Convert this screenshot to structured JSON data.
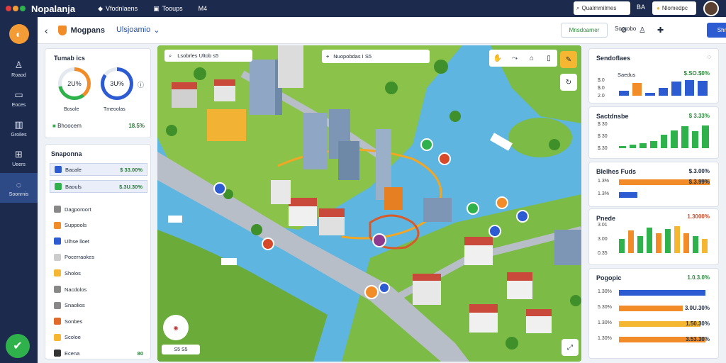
{
  "topbar": {
    "brand": "Nopalanja",
    "nav": [
      "Vfodnlaens",
      "Tooups",
      "M4"
    ],
    "search_placeholder": "Qualmmilmes",
    "lang": "BA",
    "notify_label": "Nlomedpc"
  },
  "leftnav": {
    "items": [
      {
        "label": "Roaod",
        "icon": "person-icon"
      },
      {
        "label": "Eoces",
        "icon": "inbox-icon"
      },
      {
        "label": "Groiles",
        "icon": "chart-icon"
      },
      {
        "label": "Ueers",
        "icon": "grid-icon"
      },
      {
        "label": "Soonrnis",
        "icon": "chat-icon"
      }
    ]
  },
  "subbar": {
    "title": "Mogpans",
    "dropdown": "Ulsjoamio",
    "btn_outline": "Mnsdoarner",
    "btn_text": "Soorobo",
    "btn_primary": "Shnaler"
  },
  "gauges": {
    "title": "Tumab ics",
    "g1_value": "2U%",
    "g1_label": "Bosole",
    "g2_value": "3U%",
    "g2_label": "Tmeoolas",
    "row_label": "Bhoocem",
    "row_value": "18.5%",
    "g1_pct": 0.72,
    "g2_pct": 0.85
  },
  "list": {
    "title": "Snaponna",
    "items": [
      {
        "label": "Bacale",
        "value": "$ 33.00%",
        "color": "#2d5bd1"
      },
      {
        "label": "Baouls",
        "value": "$.3U.30%",
        "color": "#2fb24c"
      },
      {
        "label": "Dagporoort",
        "value": "",
        "color": "#888888"
      },
      {
        "label": "Suppools",
        "value": "",
        "color": "#f28c28"
      },
      {
        "label": "Ulhse lloet",
        "value": "",
        "color": "#2d5bd1"
      },
      {
        "label": "Pocerraokes",
        "value": "",
        "color": "#cccccc"
      },
      {
        "label": "Sholos",
        "value": "",
        "color": "#f5b731"
      },
      {
        "label": "Nacdolos",
        "value": "",
        "color": "#888888"
      },
      {
        "label": "Snaolios",
        "value": "",
        "color": "#888888"
      },
      {
        "label": "Sonbes",
        "value": "",
        "color": "#e06a2a"
      },
      {
        "label": "Scoloe",
        "value": "",
        "color": "#f5b731"
      },
      {
        "label": "Ecena",
        "value": "80",
        "color": "#333333"
      }
    ]
  },
  "map": {
    "search_text": "Lsobrles  Ultob  s5",
    "search2_text": "Nuopobdas  I  S5",
    "coords": "S5 S5"
  },
  "right": {
    "c1": {
      "title": "Sendoflaes",
      "sub": "Saedus",
      "value": "$.SO.$0%",
      "ticks": [
        "$.0",
        "$.0",
        "2.0"
      ],
      "bars": [
        0.3,
        0.8,
        0.2,
        0.5,
        0.9,
        1.0,
        0.95
      ]
    },
    "c2": {
      "title": "Sactdnsbe",
      "value": "$ 3.33%",
      "ticks": [
        "$ 30",
        "$ 30",
        "$.30"
      ],
      "bars": [
        0.1,
        0.15,
        0.2,
        0.3,
        0.55,
        0.75,
        0.9,
        0.7,
        0.95
      ]
    },
    "c3": {
      "title": "Blelhes Fuds",
      "value": "$.3.00%",
      "ticks": [
        "1.3%",
        "1.3%"
      ],
      "bars": [
        1.0,
        0.2
      ],
      "bar_values": [
        "$.3.99%",
        ""
      ]
    },
    "c4": {
      "title": "Pnede",
      "value": "1.3000%",
      "ticks": [
        "3.01",
        "3.00",
        "0.35"
      ],
      "bars": [
        0.5,
        0.8,
        0.6,
        0.9,
        0.7,
        0.85,
        0.95,
        0.7,
        0.6,
        0.5
      ]
    },
    "c5": {
      "title": "Pogopic",
      "value": "1.0.3.0%",
      "ticks": [
        "1.30%",
        "5.30%",
        "1.30%",
        "1.30%"
      ],
      "bars": [
        0.95,
        0.7,
        0.9,
        0.95
      ],
      "bar_values": [
        "",
        "3.0U.30%",
        "1.50.30%",
        "3.53.30%"
      ]
    }
  },
  "colors": {
    "navy": "#1c2a4d",
    "accent_blue": "#2d5bd1",
    "green": "#2fb24c",
    "orange": "#f28c28"
  }
}
